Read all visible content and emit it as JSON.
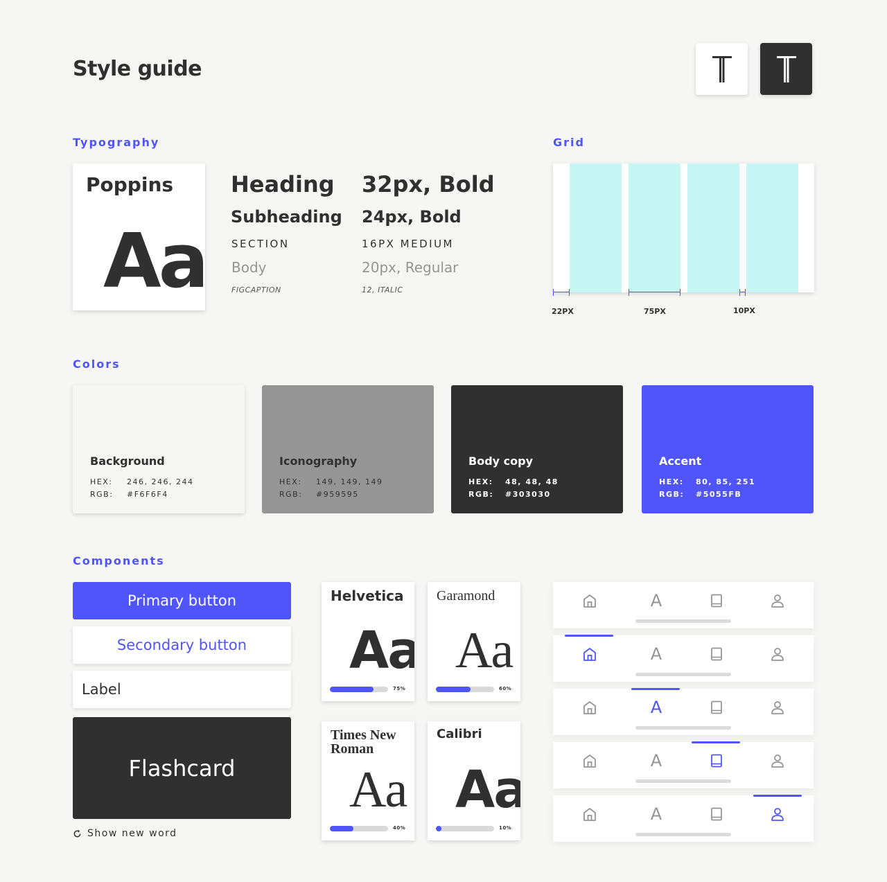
{
  "header": {
    "title": "Style guide",
    "theme_toggle": [
      "light-theme-button",
      "dark-theme-button"
    ]
  },
  "sections": {
    "typography": "Typography",
    "grid": "Grid",
    "colors": "Colors",
    "components": "Components"
  },
  "typography": {
    "font_card": {
      "name": "Poppins",
      "sample": "Aa"
    },
    "rows": [
      {
        "style": "Heading",
        "spec": "32px, Bold"
      },
      {
        "style": "Subheading",
        "spec": "24px, Bold"
      },
      {
        "style": "SECTION",
        "spec": "16PX MEDIUM"
      },
      {
        "style": "Body",
        "spec": "20px, Regular"
      },
      {
        "style": "FIGCAPTION",
        "spec": "12, ITALIC"
      }
    ]
  },
  "grid": {
    "labels": [
      "22PX",
      "75PX",
      "10PX"
    ]
  },
  "colors": [
    {
      "name": "Background",
      "hex_label": "HEX:",
      "hex": "246, 246, 244",
      "rgb_label": "RGB:",
      "rgb": "#F6F6F4",
      "swatch": "#f6f6f4",
      "text": "#303030"
    },
    {
      "name": "Iconography",
      "hex_label": "HEX:",
      "hex": "149, 149, 149",
      "rgb_label": "RGB:",
      "rgb": "#959595",
      "swatch": "#959595",
      "text": "#303030"
    },
    {
      "name": "Body copy",
      "hex_label": "HEX:",
      "hex": "48, 48, 48",
      "rgb_label": "RGB:",
      "rgb": "#303030",
      "swatch": "#303030",
      "text": "#ffffff"
    },
    {
      "name": "Accent",
      "hex_label": "HEX:",
      "hex": "80, 85, 251",
      "rgb_label": "RGB:",
      "rgb": "#5055FB",
      "swatch": "#5055fb",
      "text": "#ffffff"
    }
  ],
  "components": {
    "primary_button": "Primary button",
    "secondary_button": "Secondary button",
    "label": "Label",
    "flashcard": "Flashcard",
    "show_new_word": "Show new word",
    "font_cards": [
      {
        "name": "Helvetica",
        "sample": "Aa",
        "progress": 0.75,
        "pct": "75%"
      },
      {
        "name": "Garamond",
        "sample": "Aa",
        "progress": 0.6,
        "pct": "60%"
      },
      {
        "name": "Times New Roman",
        "sample": "Aa",
        "progress": 0.4,
        "pct": "40%"
      },
      {
        "name": "Calibri",
        "sample": "Aa",
        "progress": 0.1,
        "pct": "10%"
      }
    ],
    "nav_bars": [
      {
        "active": "none"
      },
      {
        "active": "home"
      },
      {
        "active": "fonts"
      },
      {
        "active": "library"
      },
      {
        "active": "profile"
      }
    ],
    "nav_icons": [
      "home-icon",
      "font-icon",
      "book-icon",
      "profile-icon"
    ],
    "nav_letter": "A"
  },
  "palette": {
    "accent": "#5055fb",
    "body": "#303030",
    "icon": "#959595",
    "bg": "#f6f6f4",
    "grid_col": "#c6f6f4"
  }
}
